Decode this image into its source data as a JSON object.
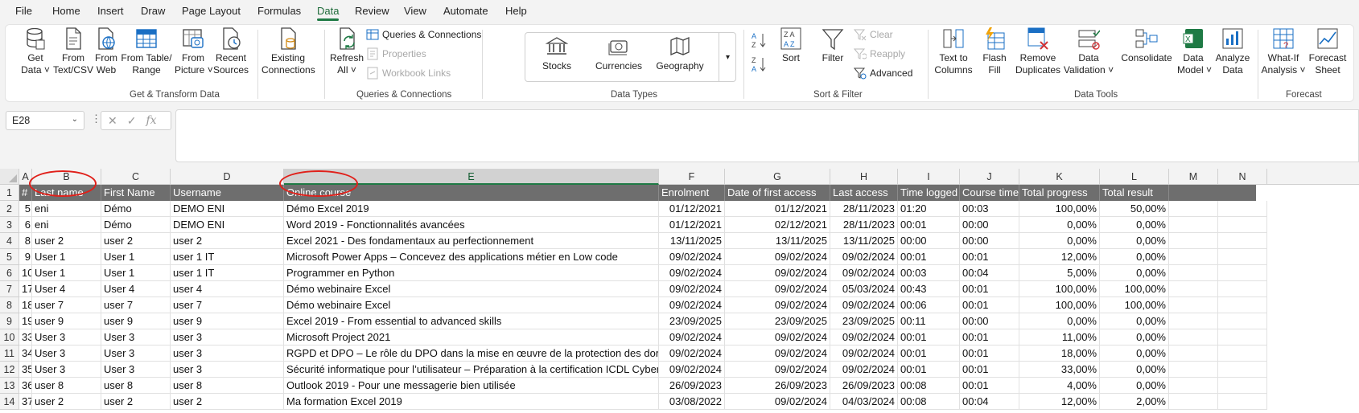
{
  "menu": [
    "File",
    "Home",
    "Insert",
    "Draw",
    "Page Layout",
    "Formulas",
    "Data",
    "Review",
    "View",
    "Automate",
    "Help"
  ],
  "ribbon": {
    "get_data": [
      "Get",
      "Data"
    ],
    "from_text": [
      "From",
      "Text/CSV"
    ],
    "from_web": [
      "From",
      "Web"
    ],
    "from_table": [
      "From Table/",
      "Range"
    ],
    "from_picture": [
      "From",
      "Picture"
    ],
    "recent_sources": [
      "Recent",
      "Sources"
    ],
    "existing_connections": [
      "Existing",
      "Connections"
    ],
    "group_get_transform": "Get & Transform Data",
    "refresh_all": [
      "Refresh",
      "All"
    ],
    "queries_connections": "Queries & Connections",
    "properties": "Properties",
    "workbook_links": "Workbook Links",
    "group_queries": "Queries & Connections",
    "stocks": "Stocks",
    "currencies": "Currencies",
    "geography": "Geography",
    "group_data_types": "Data Types",
    "sort": "Sort",
    "filter": "Filter",
    "clear": "Clear",
    "reapply": "Reapply",
    "advanced": "Advanced",
    "group_sort_filter": "Sort & Filter",
    "text_to_columns": [
      "Text to",
      "Columns"
    ],
    "flash_fill": [
      "Flash",
      "Fill"
    ],
    "remove_duplicates": [
      "Remove",
      "Duplicates"
    ],
    "data_validation": [
      "Data",
      "Validation"
    ],
    "consolidate": "Consolidate",
    "data_model": [
      "Data",
      "Model"
    ],
    "analyze_data": [
      "Analyze",
      "Data"
    ],
    "group_data_tools": "Data Tools",
    "what_if": [
      "What-If",
      "Analysis"
    ],
    "forecast_sheet": [
      "Forecast",
      "Sheet"
    ],
    "group_forecast": "Forecast"
  },
  "name_box": "E28",
  "columns": [
    "A",
    "B",
    "C",
    "D",
    "E",
    "F",
    "G",
    "H",
    "I",
    "J",
    "K",
    "L",
    "M",
    "N"
  ],
  "headers": [
    "#",
    "Last name",
    "First Name",
    "Username",
    "Online course",
    "Enrolment",
    "Date of first access",
    "Last access",
    "Time logged",
    "Course time",
    "Total progress",
    "Total result"
  ],
  "row_numbers": [
    "1",
    "2",
    "3",
    "4",
    "5",
    "6",
    "7",
    "8",
    "9",
    "10",
    "11",
    "12",
    "13",
    "14"
  ],
  "rows": [
    [
      "5",
      "eni",
      "Démo",
      "DEMO ENI",
      "Démo Excel 2019",
      "01/12/2021",
      "01/12/2021",
      "28/11/2023",
      "01:20",
      "00:03",
      "100,00%",
      "50,00%"
    ],
    [
      "6",
      "eni",
      "Démo",
      "DEMO ENI",
      "Word 2019 - Fonctionnalités avancées",
      "01/12/2021",
      "02/12/2021",
      "28/11/2023",
      "00:01",
      "00:00",
      "0,00%",
      "0,00%"
    ],
    [
      "8",
      "user 2",
      "user 2",
      "user 2",
      "Excel 2021 - Des fondamentaux au perfectionnement",
      "13/11/2025",
      "13/11/2025",
      "13/11/2025",
      "00:00",
      "00:00",
      "0,00%",
      "0,00%"
    ],
    [
      "9",
      "User 1",
      "User 1",
      "user 1 IT",
      "Microsoft Power Apps – Concevez des applications métier en Low code",
      "09/02/2024",
      "09/02/2024",
      "09/02/2024",
      "00:01",
      "00:01",
      "12,00%",
      "0,00%"
    ],
    [
      "10",
      "User 1",
      "User 1",
      "user 1 IT",
      "Programmer en Python",
      "09/02/2024",
      "09/02/2024",
      "09/02/2024",
      "00:03",
      "00:04",
      "5,00%",
      "0,00%"
    ],
    [
      "17",
      "User 4",
      "User 4",
      "user 4",
      "Démo webinaire Excel",
      "09/02/2024",
      "09/02/2024",
      "05/03/2024",
      "00:43",
      "00:01",
      "100,00%",
      "100,00%"
    ],
    [
      "18",
      "user 7",
      "user 7",
      "user 7",
      "Démo webinaire Excel",
      "09/02/2024",
      "09/02/2024",
      "09/02/2024",
      "00:06",
      "00:01",
      "100,00%",
      "100,00%"
    ],
    [
      "19",
      "user 9",
      "user 9",
      "user 9",
      "Excel 2019 - From essential to advanced skills",
      "23/09/2025",
      "23/09/2025",
      "23/09/2025",
      "00:11",
      "00:00",
      "0,00%",
      "0,00%"
    ],
    [
      "33",
      "User 3",
      "User 3",
      "user 3",
      "Microsoft Project 2021",
      "09/02/2024",
      "09/02/2024",
      "09/02/2024",
      "00:01",
      "00:01",
      "11,00%",
      "0,00%"
    ],
    [
      "34",
      "User 3",
      "User 3",
      "user 3",
      "RGPD et DPO – Le rôle du DPO dans la mise en œuvre de la protection des données",
      "09/02/2024",
      "09/02/2024",
      "09/02/2024",
      "00:01",
      "00:01",
      "18,00%",
      "0,00%"
    ],
    [
      "35",
      "User 3",
      "User 3",
      "user 3",
      "Sécurité informatique pour l’utilisateur – Préparation à la certification ICDL Cyber",
      "09/02/2024",
      "09/02/2024",
      "09/02/2024",
      "00:01",
      "00:01",
      "33,00%",
      "0,00%"
    ],
    [
      "36",
      "user 8",
      "user 8",
      "user 8",
      "Outlook 2019  - Pour une messagerie bien utilisée",
      "26/09/2023",
      "26/09/2023",
      "26/09/2023",
      "00:08",
      "00:01",
      "4,00%",
      "0,00%"
    ],
    [
      "37",
      "user 2",
      "user 2",
      "user 2",
      "Ma formation Excel 2019",
      "03/08/2022",
      "09/02/2024",
      "04/03/2024",
      "00:08",
      "00:04",
      "12,00%",
      "2,00%"
    ]
  ],
  "colors": {
    "accent": "#1f7a45",
    "header_fill": "#6e6e6e",
    "annotation": "#e0201a"
  },
  "annotations": [
    "circle-last-name-header",
    "circle-online-course-header"
  ]
}
